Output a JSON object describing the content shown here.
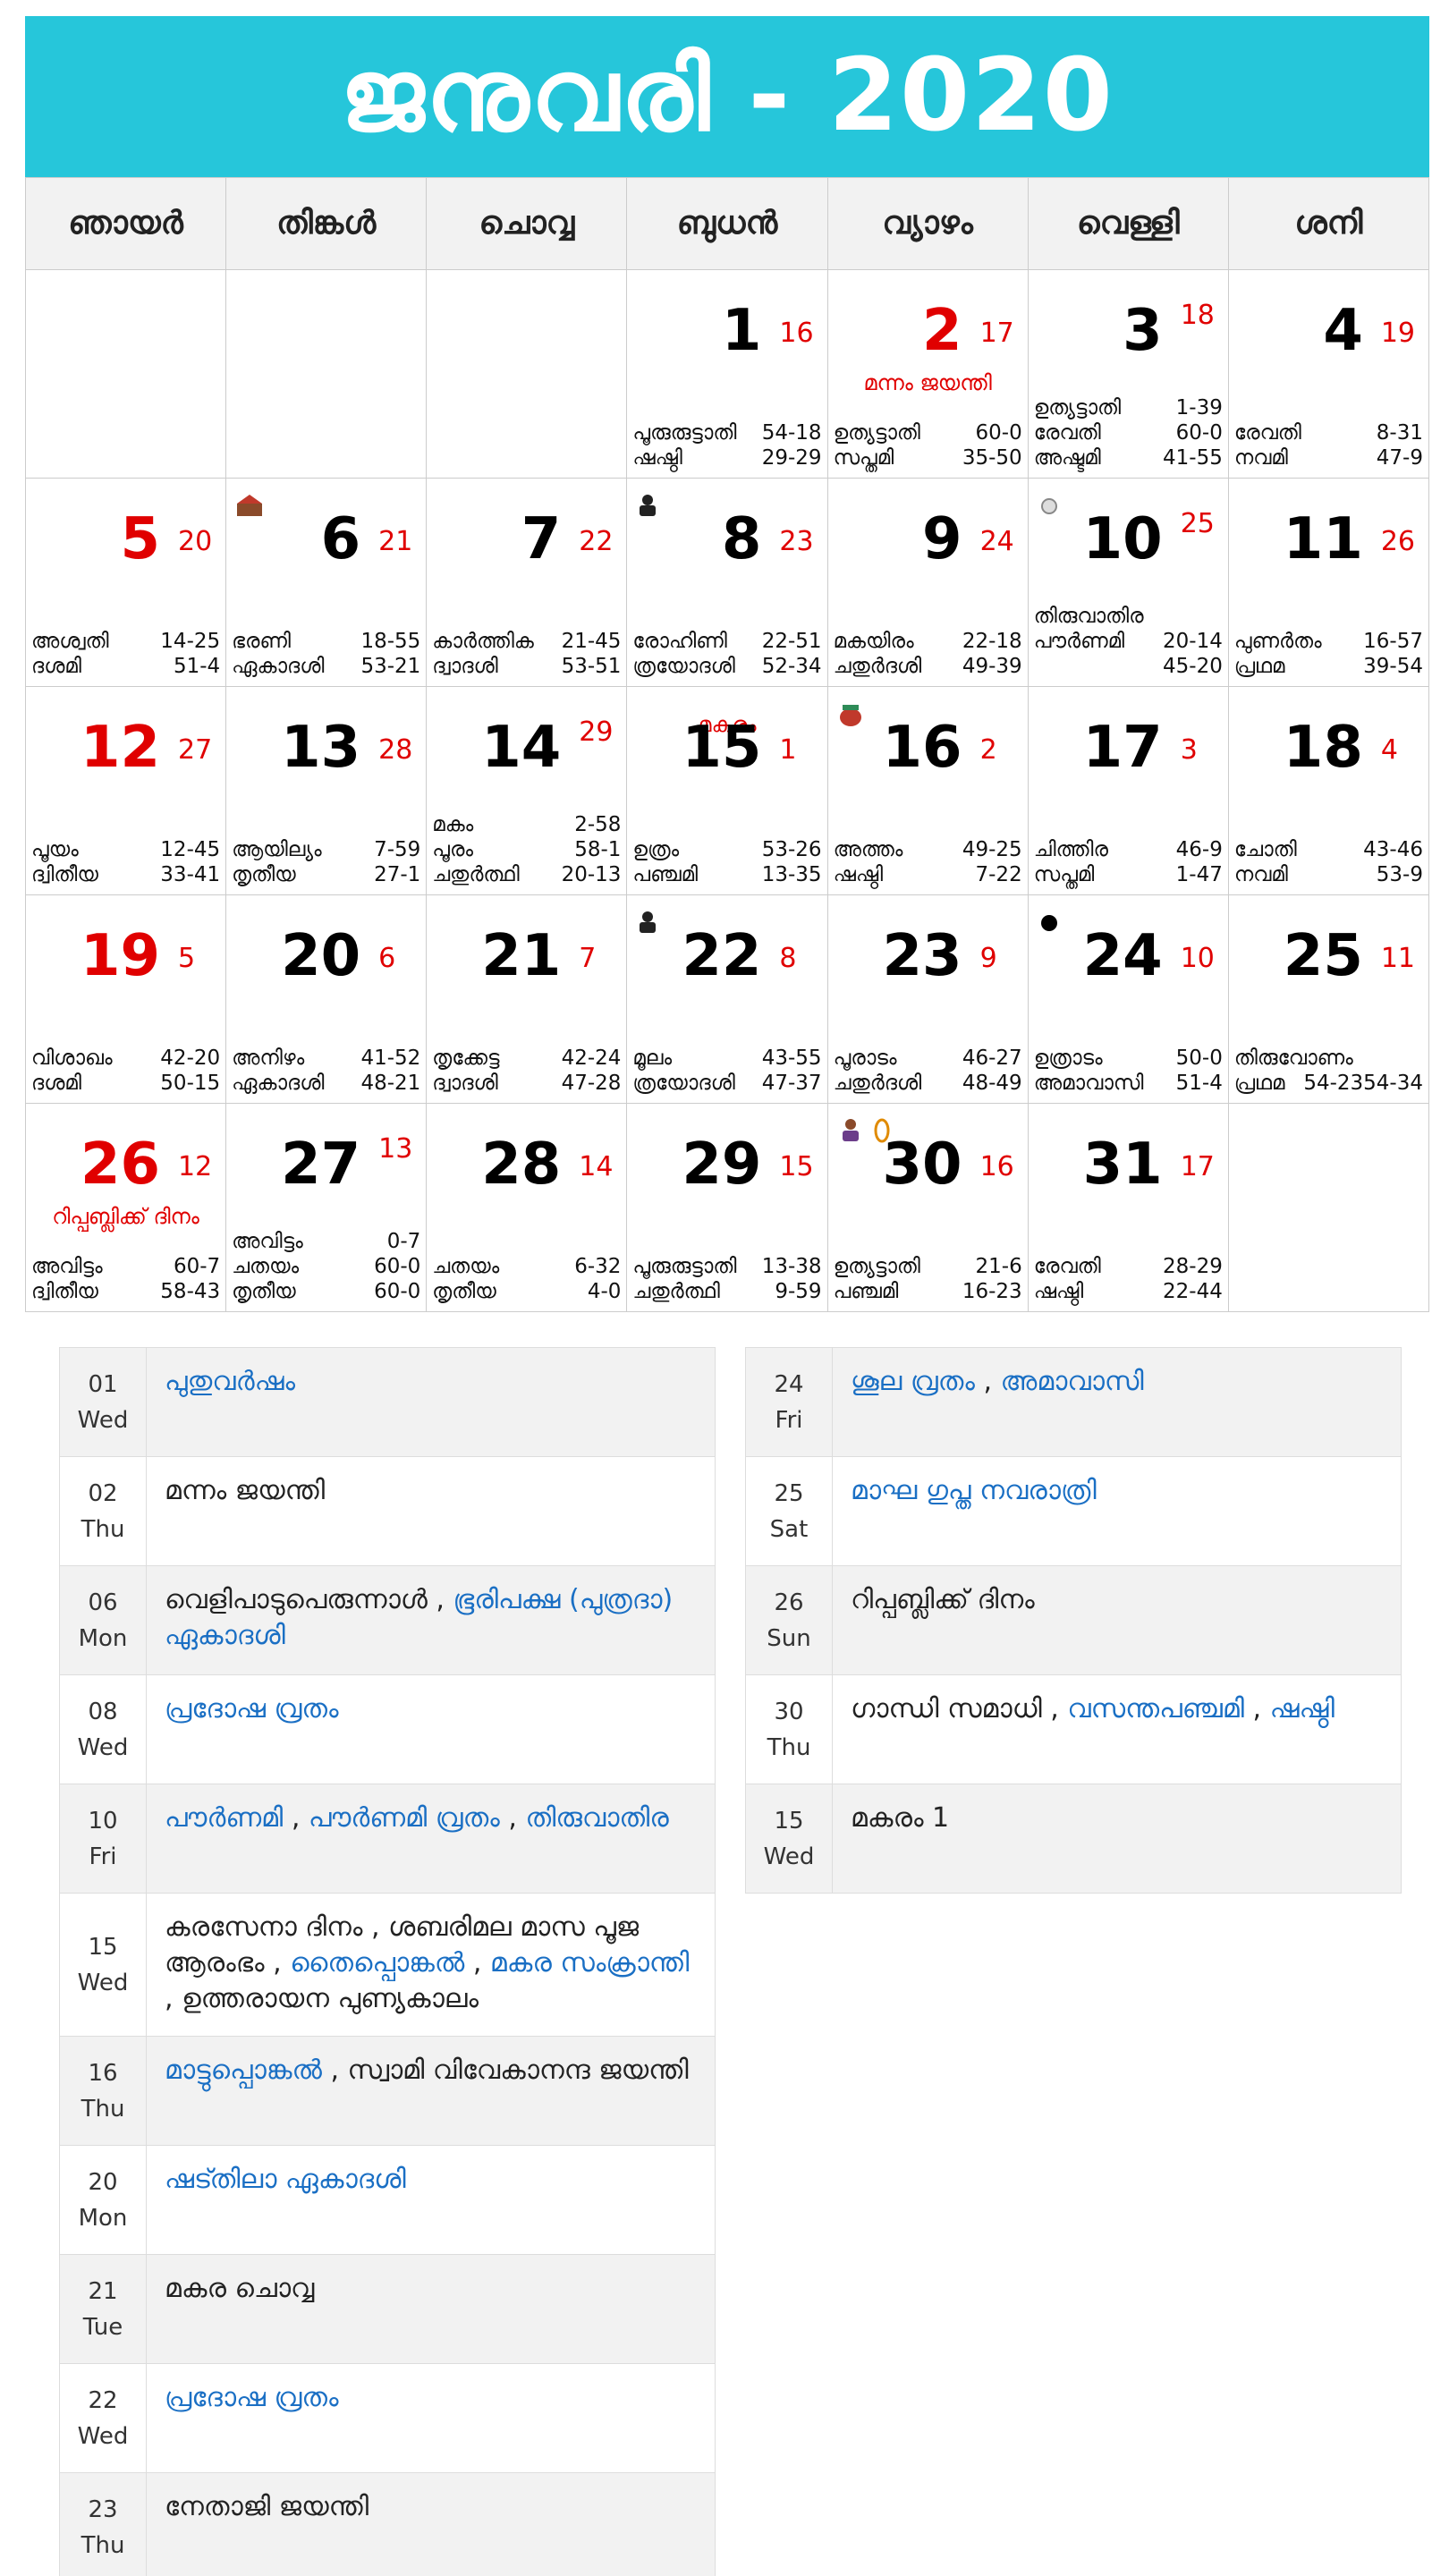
{
  "title": "ജനുവരി - 2020",
  "weekdays": [
    "ഞായർ",
    "തിങ്കൾ",
    "ചൊവ്വ",
    "ബുധൻ",
    "വ്യാഴം",
    "വെള്ളി",
    "ശനി"
  ],
  "days": {
    "d1": {
      "num": "1",
      "t": "16",
      "s1": "പൂരുരുട്ടാതി",
      "v1": "54-18",
      "s2": "ഷഷ്ഠി",
      "v2": "29-29"
    },
    "d2": {
      "num": "2",
      "t": "17",
      "fest": "മന്നം ജയന്തി",
      "s1": "ഉത്യട്ടാതി",
      "v1": "60-0",
      "s2": "സപ്തമി",
      "v2": "35-50"
    },
    "d3": {
      "num": "3",
      "t": "18",
      "s0": "ഉത്യട്ടാതി",
      "v0": "1-39",
      "s1": "രേവതി",
      "v1": "60-0",
      "s2": "അഷ്ടമി",
      "v2": "41-55"
    },
    "d4": {
      "num": "4",
      "t": "19",
      "s1": "രേവതി",
      "v1": "8-31",
      "s2": "നവമി",
      "v2": "47-9"
    },
    "d5": {
      "num": "5",
      "t": "20",
      "s1": "അശ്വതി",
      "v1": "14-25",
      "s2": "ദശമി",
      "v2": "51-4"
    },
    "d6": {
      "num": "6",
      "t": "21",
      "s1": "ഭരണി",
      "v1": "18-55",
      "s2": "ഏകാദശി",
      "v2": "53-21"
    },
    "d7": {
      "num": "7",
      "t": "22",
      "s1": "കാർത്തിക",
      "v1": "21-45",
      "s2": "ദ്വാദശി",
      "v2": "53-51"
    },
    "d8": {
      "num": "8",
      "t": "23",
      "s1": "രോഹിണി",
      "v1": "22-51",
      "s2": "ത്രയോദശി",
      "v2": "52-34"
    },
    "d9": {
      "num": "9",
      "t": "24",
      "s1": "മകയിരം",
      "v1": "22-18",
      "s2": "ചതുർദശി",
      "v2": "49-39"
    },
    "d10": {
      "num": "10",
      "t": "25",
      "s0": "തിരുവാതിര",
      "v0": "",
      "s1": "പൗർണമി",
      "v1": "20-14",
      "s2": "",
      "v2": "45-20"
    },
    "d11": {
      "num": "11",
      "t": "26",
      "s1": "പുണർതം",
      "v1": "16-57",
      "s2": "പ്രഥമ",
      "v2": "39-54"
    },
    "d12": {
      "num": "12",
      "t": "27",
      "s1": "പൂയം",
      "v1": "12-45",
      "s2": "ദ്വിതീയ",
      "v2": "33-41"
    },
    "d13": {
      "num": "13",
      "t": "28",
      "s1": "ആയില്യം",
      "v1": "7-59",
      "s2": "തൃതീയ",
      "v2": "27-1"
    },
    "d14": {
      "num": "14",
      "t": "29",
      "s0": "മകം",
      "v0": "2-58",
      "s1": "പൂരം",
      "v1": "58-1",
      "s2": "ചതുർത്ഥി",
      "v2": "20-13"
    },
    "d15": {
      "num": "15",
      "t": "1",
      "mtop": "മകരം",
      "s1": "ഉത്രം",
      "v1": "53-26",
      "s2": "പഞ്ചമി",
      "v2": "13-35"
    },
    "d16": {
      "num": "16",
      "t": "2",
      "s1": "അത്തം",
      "v1": "49-25",
      "s2": "ഷഷ്ഠി",
      "v2": "7-22"
    },
    "d17": {
      "num": "17",
      "t": "3",
      "s1": "ചിത്തിര",
      "v1": "46-9",
      "s2": "സപ്തമി",
      "v2": "1-47"
    },
    "d18": {
      "num": "18",
      "t": "4",
      "s1": "ചോതി",
      "v1": "43-46",
      "s2": "നവമി",
      "v2": "53-9"
    },
    "d19": {
      "num": "19",
      "t": "5",
      "s1": "വിശാഖം",
      "v1": "42-20",
      "s2": "ദശമി",
      "v2": "50-15"
    },
    "d20": {
      "num": "20",
      "t": "6",
      "s1": "അനിഴം",
      "v1": "41-52",
      "s2": "ഏകാദശി",
      "v2": "48-21"
    },
    "d21": {
      "num": "21",
      "t": "7",
      "s1": "തൃക്കേട്ട",
      "v1": "42-24",
      "s2": "ദ്വാദശി",
      "v2": "47-28"
    },
    "d22": {
      "num": "22",
      "t": "8",
      "s1": "മൂലം",
      "v1": "43-55",
      "s2": "ത്രയോദശി",
      "v2": "47-37"
    },
    "d23": {
      "num": "23",
      "t": "9",
      "s1": "പൂരാടം",
      "v1": "46-27",
      "s2": "ചതുർദശി",
      "v2": "48-49"
    },
    "d24": {
      "num": "24",
      "t": "10",
      "s1": "ഉത്രാടം",
      "v1": "50-0",
      "s2": "അമാവാസി",
      "v2": "51-4"
    },
    "d25": {
      "num": "25",
      "t": "11",
      "s1": "തിരുവോണം",
      "v1": "",
      "s2": "പ്രഥമ",
      "v2": "54-2354-34"
    },
    "d26": {
      "num": "26",
      "t": "12",
      "fest": "റിപ്പബ്ലിക്ക് ദിനം",
      "s1": "അവിട്ടം",
      "v1": "60-7",
      "s2": "ദ്വിതീയ",
      "v2": "58-43"
    },
    "d27": {
      "num": "27",
      "t": "13",
      "s0": "അവിട്ടം",
      "v0": "0-7",
      "s1": "ചതയം",
      "v1": "60-0",
      "s2": "തൃതീയ",
      "v2": "60-0"
    },
    "d28": {
      "num": "28",
      "t": "14",
      "s1": "ചതയം",
      "v1": "6-32",
      "s2": "തൃതീയ",
      "v2": "4-0"
    },
    "d29": {
      "num": "29",
      "t": "15",
      "s1": "പൂരുരുട്ടാതി",
      "v1": "13-38",
      "s2": "ചതുർത്ഥി",
      "v2": "9-59"
    },
    "d30": {
      "num": "30",
      "t": "16",
      "s1": "ഉത്യട്ടാതി",
      "v1": "21-6",
      "s2": "പഞ്ചമി",
      "v2": "16-23"
    },
    "d31": {
      "num": "31",
      "t": "17",
      "s1": "രേവതി",
      "v1": "28-29",
      "s2": "ഷഷ്ഠി",
      "v2": "22-44"
    }
  },
  "events_left": [
    {
      "day": "01",
      "wd": "Wed",
      "parts": [
        {
          "t": "പുതുവർഷം",
          "link": true
        }
      ]
    },
    {
      "day": "02",
      "wd": "Thu",
      "parts": [
        {
          "t": "മന്നം ജയന്തി",
          "link": false
        }
      ]
    },
    {
      "day": "06",
      "wd": "Mon",
      "parts": [
        {
          "t": "വെളിപാടുപെരുന്നാൾ , ",
          "link": false
        },
        {
          "t": "ഭൂരിപക്ഷ (പുത്രദാ) ഏകാദശി",
          "link": true
        }
      ]
    },
    {
      "day": "08",
      "wd": "Wed",
      "parts": [
        {
          "t": "പ്രദോഷ വ്രതം",
          "link": true
        }
      ]
    },
    {
      "day": "10",
      "wd": "Fri",
      "parts": [
        {
          "t": "പൗർണമി",
          "link": true
        },
        {
          "t": " , ",
          "link": false
        },
        {
          "t": "പൗർണമി വ്രതം",
          "link": true
        },
        {
          "t": " , ",
          "link": false
        },
        {
          "t": "തിരുവാതിര",
          "link": true
        }
      ]
    },
    {
      "day": "15",
      "wd": "Wed",
      "parts": [
        {
          "t": "കരസേനാ ദിനം , ശബരിമല മാസ പൂജ ആരംഭം , ",
          "link": false
        },
        {
          "t": "തൈപ്പൊങ്കൽ",
          "link": true
        },
        {
          "t": " , ",
          "link": false
        },
        {
          "t": "മകര സംക്രാന്തി",
          "link": true
        },
        {
          "t": " , ഉത്തരായന പുണ്യകാലം",
          "link": false
        }
      ]
    },
    {
      "day": "16",
      "wd": "Thu",
      "parts": [
        {
          "t": "മാട്ടുപ്പൊങ്കൽ",
          "link": true
        },
        {
          "t": " , സ്വാമി വിവേകാനന്ദ ജയന്തി",
          "link": false
        }
      ]
    },
    {
      "day": "20",
      "wd": "Mon",
      "parts": [
        {
          "t": "ഷട്തിലാ ഏകാദശി",
          "link": true
        }
      ]
    },
    {
      "day": "21",
      "wd": "Tue",
      "parts": [
        {
          "t": "മകര ചൊവ്വ",
          "link": false
        }
      ]
    },
    {
      "day": "22",
      "wd": "Wed",
      "parts": [
        {
          "t": "പ്രദോഷ വ്രതം",
          "link": true
        }
      ]
    },
    {
      "day": "23",
      "wd": "Thu",
      "parts": [
        {
          "t": "നേതാജി ജയന്തി",
          "link": false
        }
      ]
    }
  ],
  "events_right": [
    {
      "day": "24",
      "wd": "Fri",
      "parts": [
        {
          "t": "ശൂല വ്രതം",
          "link": true
        },
        {
          "t": " , ",
          "link": false
        },
        {
          "t": "അമാവാസി",
          "link": true
        }
      ]
    },
    {
      "day": "25",
      "wd": "Sat",
      "parts": [
        {
          "t": "മാഘ ഗുപ്ത നവരാത്രി",
          "link": true
        }
      ]
    },
    {
      "day": "26",
      "wd": "Sun",
      "parts": [
        {
          "t": "റിപ്പബ്ലിക്ക് ദിനം",
          "link": false
        }
      ]
    },
    {
      "day": "30",
      "wd": "Thu",
      "parts": [
        {
          "t": "ഗാന്ധി സമാധി , ",
          "link": false
        },
        {
          "t": "വസന്തപഞ്ചമി",
          "link": true
        },
        {
          "t": " , ",
          "link": false
        },
        {
          "t": "ഷഷ്ഠി",
          "link": true
        }
      ]
    },
    {
      "day": "15",
      "wd": "Wed",
      "parts": [
        {
          "t": "മകരം 1",
          "link": false
        }
      ]
    }
  ],
  "colors": {
    "header": "#26c6da",
    "holiday": "#e00000",
    "link": "#1a6fc4"
  }
}
